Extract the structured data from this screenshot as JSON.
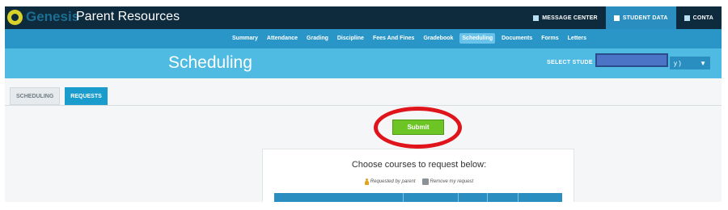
{
  "header": {
    "logo_text": "Genesis",
    "app_title": "Parent Resources",
    "links": [
      {
        "label": "MESSAGE CENTER",
        "icon": "home-icon"
      },
      {
        "label": "STUDENT DATA",
        "icon": "users-icon"
      },
      {
        "label": "CONTA",
        "icon": "contact-icon"
      }
    ],
    "active_link": "STUDENT DATA"
  },
  "subnav": {
    "items": [
      "Summary",
      "Attendance",
      "Grading",
      "Discipline",
      "Fees And Fines",
      "Gradebook",
      "Scheduling",
      "Documents",
      "Forms",
      "Letters"
    ],
    "active": "Scheduling"
  },
  "page": {
    "title": "Scheduling",
    "select_student_label": "SELECT STUDE",
    "student_select_value": "y )",
    "select_caret": "▼"
  },
  "tabs": {
    "items": [
      "SCHEDULING",
      "REQUESTS"
    ],
    "active": "REQUESTS"
  },
  "actions": {
    "submit_label": "Submit",
    "highlight_color": "#e0141b"
  },
  "requests_panel": {
    "heading": "Choose courses to request below:",
    "legend_requested": "Requested by parent",
    "legend_remove": "Remove my request"
  },
  "colors": {
    "header_bg": "#0e2a3d",
    "nav_bg": "#2a96c8",
    "title_bg": "#4fbbe3",
    "accent": "#1a9ccc",
    "submit_green": "#6cc524"
  }
}
